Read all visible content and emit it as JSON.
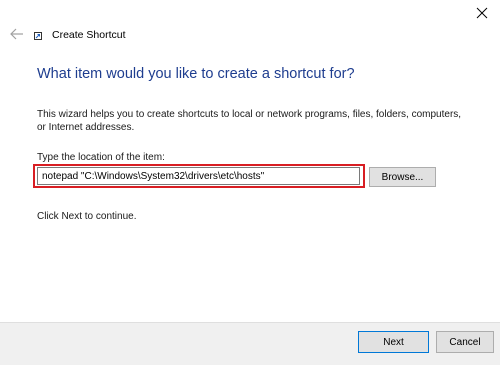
{
  "window": {
    "title": "Create Shortcut",
    "close_icon": "close-icon",
    "back_icon": "back-arrow-icon",
    "app_icon": "shortcut-app-icon"
  },
  "main": {
    "heading": "What item would you like to create a shortcut for?",
    "description": "This wizard helps you to create shortcuts to local or network programs, files, folders, computers, or Internet addresses.",
    "field_label": "Type the location of the item:",
    "location_value": "notepad \"C:\\Windows\\System32\\drivers\\etc\\hosts\"",
    "browse_label": "Browse...",
    "hint": "Click Next to continue."
  },
  "footer": {
    "next_label": "Next",
    "cancel_label": "Cancel"
  },
  "colors": {
    "heading": "#1e3d8f",
    "highlight": "#d81e23",
    "focus_border": "#0078d7"
  }
}
